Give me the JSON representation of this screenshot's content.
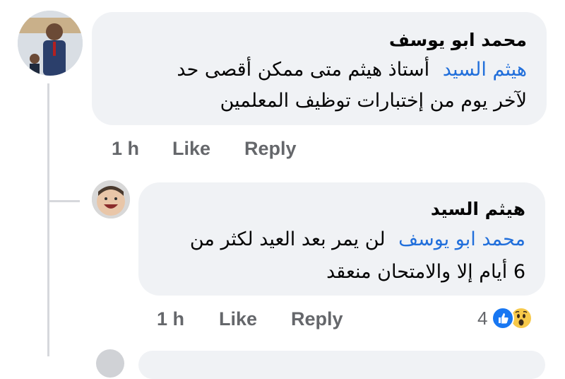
{
  "comment": {
    "author": "محمد ابو يوسف",
    "mention": "هيثم السيد",
    "text_line1": "أستاذ هيثم متى ممكن أقصى حد",
    "text_line2": "لآخر يوم من إختبارات توظيف المعلمين",
    "time": "1 h",
    "like_label": "Like",
    "reply_label": "Reply"
  },
  "reply": {
    "author": "هيثم السيد",
    "mention": "محمد ابو يوسف",
    "text_line1": "لن يمر بعد العيد لكثر من",
    "text_line2": "6 أيام إلا والامتحان منعقد",
    "time": "1 h",
    "like_label": "Like",
    "reply_label": "Reply",
    "reaction_count": "4",
    "reaction_icons": [
      "like-icon",
      "wow-icon"
    ]
  },
  "colors": {
    "bubble": "#f0f2f5",
    "mention": "#216fdb",
    "meta": "#65676b",
    "thread_line": "#d6d8dc",
    "like_reaction": "#1877f2",
    "wow_reaction": "#f7c94a"
  }
}
